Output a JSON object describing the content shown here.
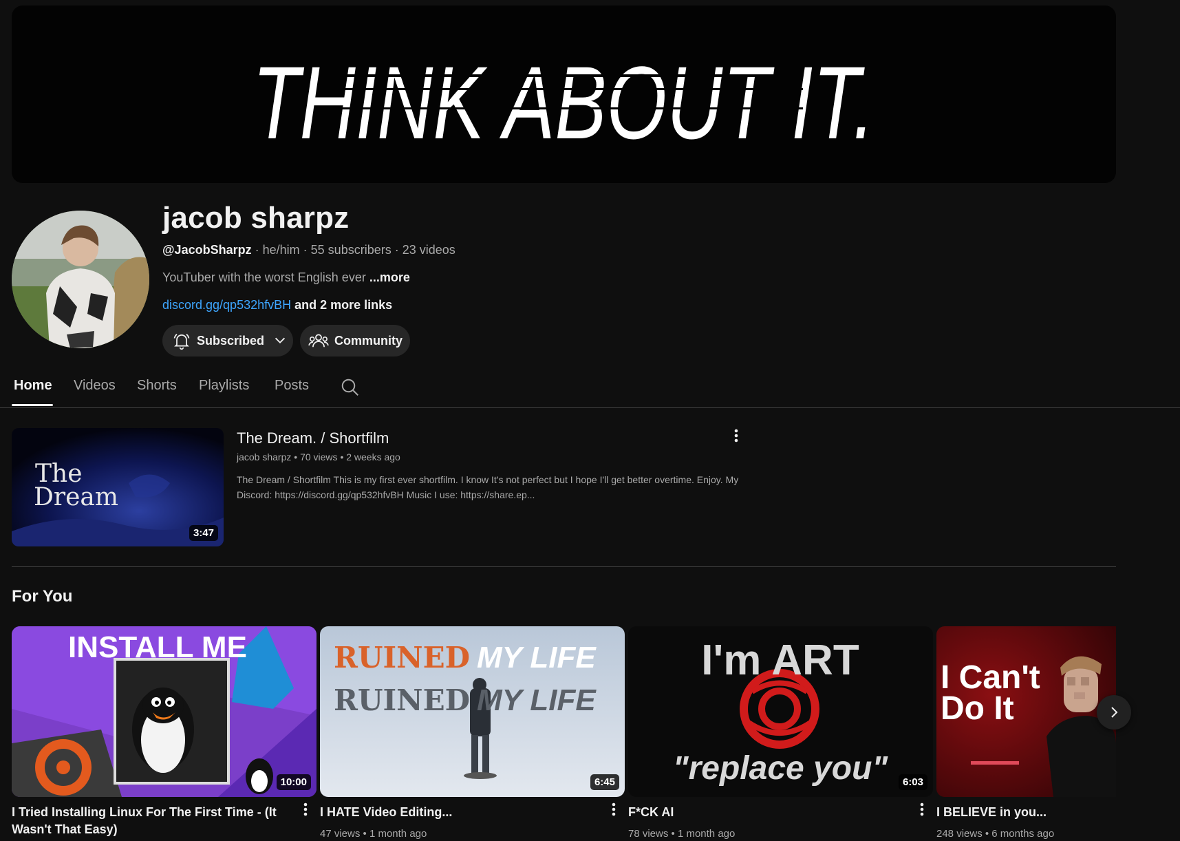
{
  "banner": {
    "text": "THINK ABOUT IT."
  },
  "channel": {
    "name": "jacob sharpz",
    "handle": "@JacobSharpz",
    "pronouns": "he/him",
    "subscribers": "55 subscribers",
    "videos_count": "23 videos",
    "description": "YouTuber with the worst English ever",
    "more_label": "...more",
    "link": "discord.gg/qp532hfvBH",
    "more_links": "and 2 more links",
    "subscribed_label": "Subscribed",
    "community_label": "Community"
  },
  "tabs": [
    {
      "label": "Home",
      "active": true
    },
    {
      "label": "Videos"
    },
    {
      "label": "Shorts"
    },
    {
      "label": "Playlists"
    },
    {
      "label": "Posts"
    }
  ],
  "featured": {
    "thumb_text_line1": "The",
    "thumb_text_line2": "Dream",
    "duration": "3:47",
    "title": "The Dream. / Shortfilm",
    "channel": "jacob sharpz",
    "views": "70 views",
    "age": "2 weeks ago",
    "description": "The Dream / Shortfilm This is my first ever shortfilm. I know It's not perfect but I hope I'll get better overtime. Enjoy. My Discord: https://discord.gg/qp532hfvBH Music I use: https://share.ep..."
  },
  "section": {
    "title": "For You"
  },
  "videos": [
    {
      "title": "I Tried Installing Linux For The First Time - (It Wasn't That Easy)",
      "duration": "10:00",
      "thumb_text": "INSTALL ME",
      "views": "",
      "age": ""
    },
    {
      "title": "I HATE Video Editing...",
      "duration": "6:45",
      "thumb_text_1": "RUINED",
      "thumb_text_2": "MY LIFE",
      "views": "47 views",
      "age": "1 month ago"
    },
    {
      "title": "F*CK AI",
      "duration": "6:03",
      "thumb_text_1": "I'm ART",
      "thumb_text_2": "\"replace you\"",
      "views": "78 views",
      "age": "1 month ago"
    },
    {
      "title": "I BELIEVE in you...",
      "thumb_text_1": "I Can't",
      "thumb_text_2": "Do It",
      "views": "248 views",
      "age": "6 months ago"
    }
  ],
  "colors": {
    "background": "#0f0f0f",
    "link": "#3ea6ff",
    "pill": "#272727",
    "muted": "#aaaaaa"
  },
  "icons": [
    "bell-icon",
    "chevron-down-icon",
    "people-icon",
    "search-icon",
    "more-vert-icon",
    "chevron-right-icon"
  ]
}
